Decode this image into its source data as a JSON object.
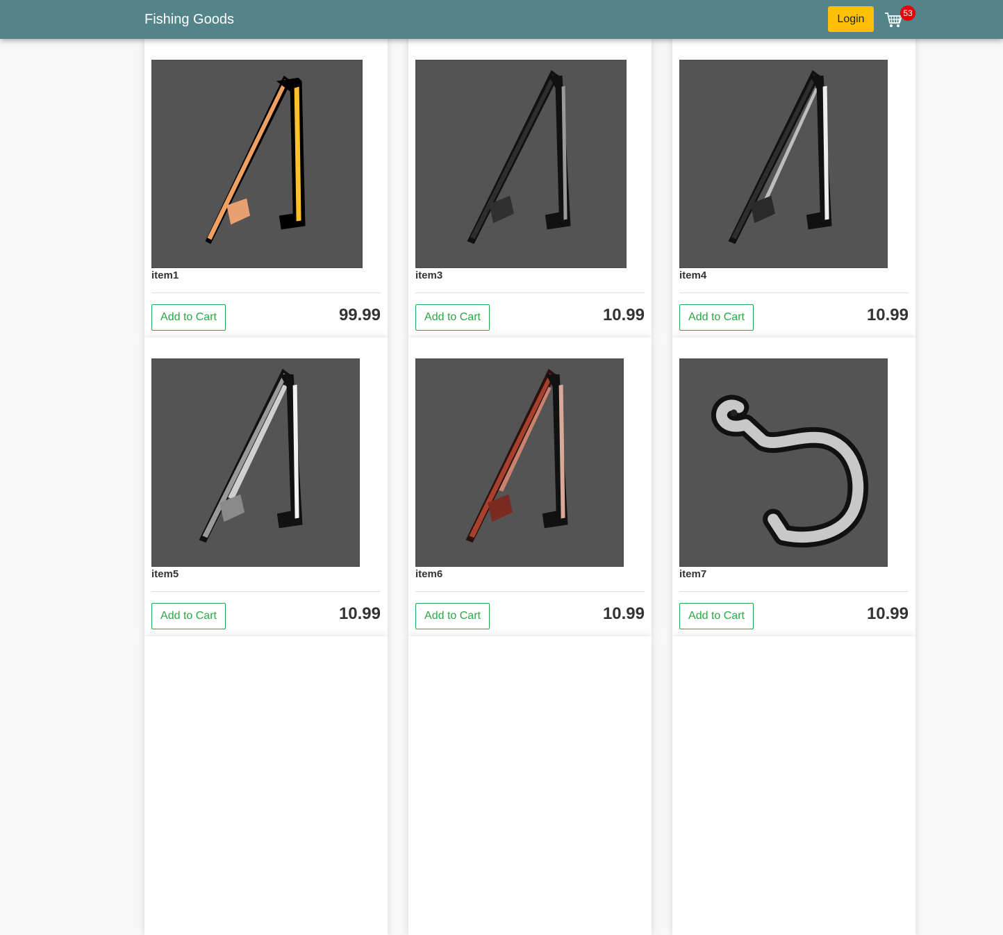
{
  "navbar": {
    "brand": "Fishing Goods",
    "login_label": "Login",
    "cart_count": "53",
    "cart_icon": "cart-icon",
    "color": "#52848a",
    "login_color": "#ffc107",
    "badge_color": "#e8000a"
  },
  "products": [
    {
      "name": "item1",
      "price": "99.99",
      "add_label": "Add to Cart",
      "image": "orange-fishing-rod"
    },
    {
      "name": "item3",
      "price": "10.99",
      "add_label": "Add to Cart",
      "image": "black-fishing-rod"
    },
    {
      "name": "item4",
      "price": "10.99",
      "add_label": "Add to Cart",
      "image": "black-white-fishing-rod"
    },
    {
      "name": "item5",
      "price": "10.99",
      "add_label": "Add to Cart",
      "image": "silver-fishing-rod"
    },
    {
      "name": "item6",
      "price": "10.99",
      "add_label": "Add to Cart",
      "image": "red-fishing-rod"
    },
    {
      "name": "item7",
      "price": "10.99",
      "add_label": "Add to Cart",
      "image": "fishing-hook"
    }
  ],
  "accent_color": "#28a745"
}
